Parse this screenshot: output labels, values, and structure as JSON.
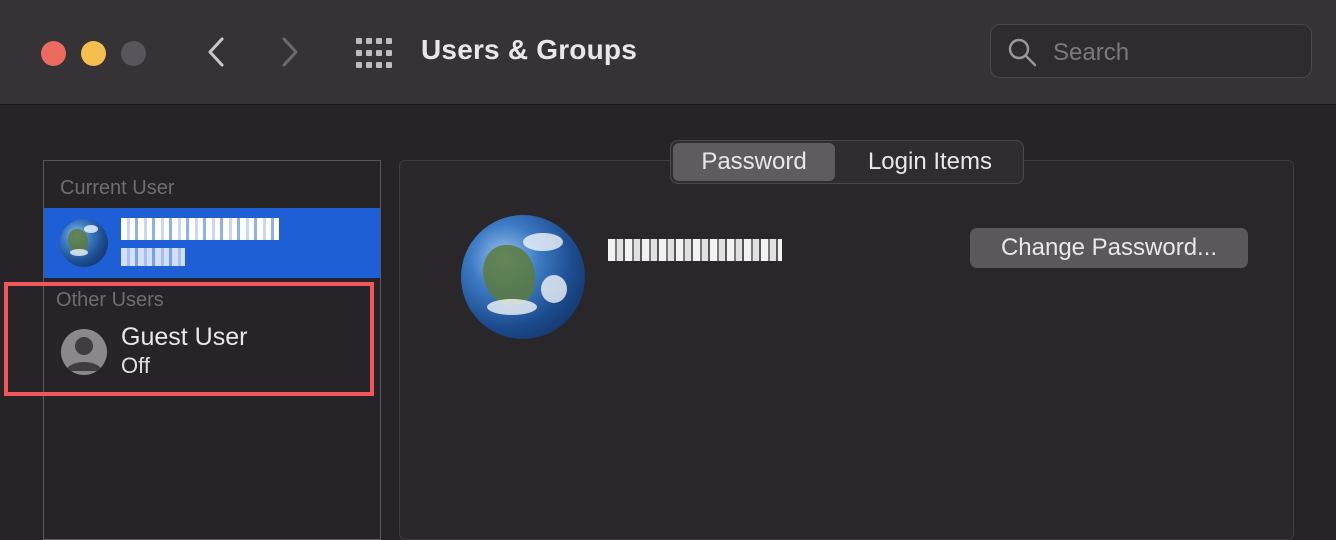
{
  "window": {
    "title": "Users & Groups",
    "search_placeholder": "Search"
  },
  "sidebar": {
    "current_label": "Current User",
    "current_user": {
      "name": "Daniel Hasson",
      "role": "Admin",
      "redacted": true
    },
    "other_label": "Other Users",
    "guest": {
      "name": "Guest User",
      "status": "Off"
    }
  },
  "tabs": [
    {
      "label": "Password",
      "active": true
    },
    {
      "label": "Login Items",
      "active": false
    }
  ],
  "main": {
    "user_name": "Daniel Hasson",
    "user_name_redacted": true,
    "change_password_label": "Change Password..."
  },
  "colors": {
    "selection": "#1f5fd6",
    "highlight_box": "#f0565a",
    "close": "#ed6a5e",
    "minimize": "#f5bf4f"
  },
  "icons": [
    "back-chevron-icon",
    "forward-chevron-icon",
    "grid-icon",
    "search-icon",
    "globe-avatar-icon",
    "person-icon"
  ]
}
